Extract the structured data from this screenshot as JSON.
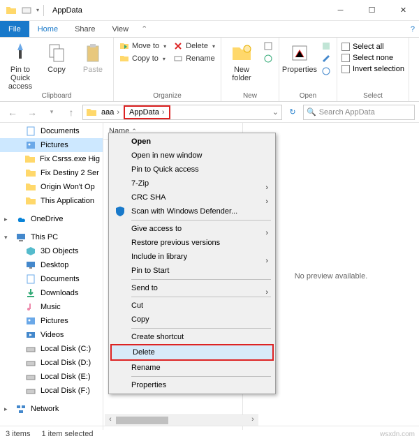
{
  "window": {
    "title": "AppData"
  },
  "menu": {
    "file": "File",
    "tabs": [
      "Home",
      "Share",
      "View"
    ]
  },
  "ribbon": {
    "clipboard": {
      "label": "Clipboard",
      "pin": "Pin to Quick\naccess",
      "copy": "Copy",
      "paste": "Paste"
    },
    "organize": {
      "label": "Organize",
      "moveto": "Move to",
      "copyto": "Copy to",
      "delete": "Delete",
      "rename": "Rename"
    },
    "new": {
      "label": "New",
      "newfolder": "New\nfolder"
    },
    "open": {
      "label": "Open",
      "properties": "Properties"
    },
    "select": {
      "label": "Select",
      "all": "Select all",
      "none": "Select none",
      "invert": "Invert selection"
    }
  },
  "address": {
    "crumbs": [
      "aaa",
      "AppData"
    ],
    "search_placeholder": "Search AppData"
  },
  "nav": {
    "quick": [
      {
        "label": "Documents",
        "icon": "documents"
      },
      {
        "label": "Pictures",
        "icon": "pictures",
        "selected": true
      },
      {
        "label": "Fix Csrss.exe Hig",
        "icon": "folder"
      },
      {
        "label": "Fix Destiny 2 Ser",
        "icon": "folder"
      },
      {
        "label": "Origin Won't Op",
        "icon": "folder"
      },
      {
        "label": "This Application",
        "icon": "folder"
      }
    ],
    "onedrive": "OneDrive",
    "thispc": "This PC",
    "pcitems": [
      {
        "label": "3D Objects",
        "icon": "3d"
      },
      {
        "label": "Desktop",
        "icon": "desktop"
      },
      {
        "label": "Documents",
        "icon": "documents"
      },
      {
        "label": "Downloads",
        "icon": "downloads"
      },
      {
        "label": "Music",
        "icon": "music"
      },
      {
        "label": "Pictures",
        "icon": "pictures"
      },
      {
        "label": "Videos",
        "icon": "videos"
      },
      {
        "label": "Local Disk (C:)",
        "icon": "disk"
      },
      {
        "label": "Local Disk (D:)",
        "icon": "disk"
      },
      {
        "label": "Local Disk (E:)",
        "icon": "disk"
      },
      {
        "label": "Local Disk (F:)",
        "icon": "disk"
      }
    ],
    "network": "Network"
  },
  "list": {
    "col": "Name",
    "preview": "No preview available."
  },
  "context": [
    {
      "label": "Open",
      "bold": true
    },
    {
      "label": "Open in new window"
    },
    {
      "label": "Pin to Quick access"
    },
    {
      "label": "7-Zip",
      "sub": true
    },
    {
      "label": "CRC SHA",
      "sub": true
    },
    {
      "label": "Scan with Windows Defender...",
      "icon": true
    },
    {
      "sep": true
    },
    {
      "label": "Give access to",
      "sub": true
    },
    {
      "label": "Restore previous versions"
    },
    {
      "label": "Include in library",
      "sub": true
    },
    {
      "label": "Pin to Start"
    },
    {
      "sep": true
    },
    {
      "label": "Send to",
      "sub": true
    },
    {
      "sep": true
    },
    {
      "label": "Cut"
    },
    {
      "label": "Copy"
    },
    {
      "sep": true
    },
    {
      "label": "Create shortcut"
    },
    {
      "label": "Delete",
      "hl": true,
      "hov": true
    },
    {
      "label": "Rename"
    },
    {
      "sep": true
    },
    {
      "label": "Properties"
    }
  ],
  "status": {
    "items": "3 items",
    "selected": "1 item selected"
  },
  "watermark": "wsxdn.com"
}
